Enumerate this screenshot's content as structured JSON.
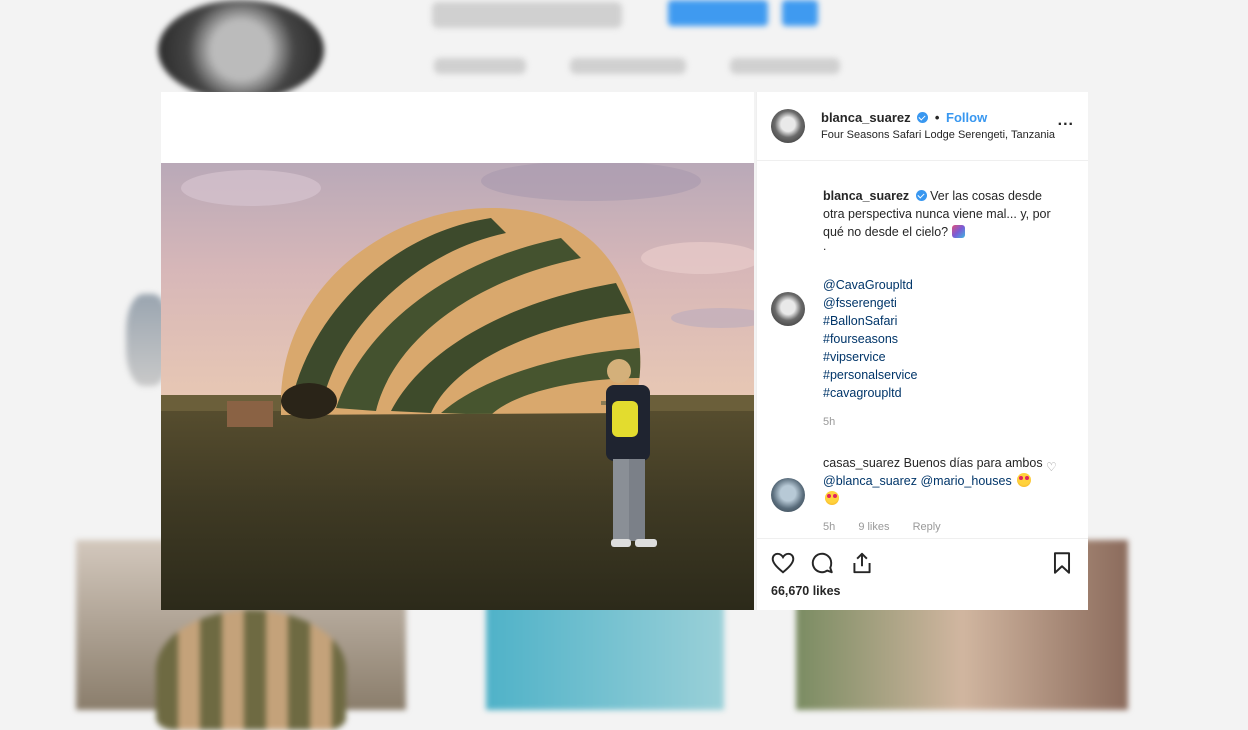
{
  "post": {
    "username": "blanca_suarez",
    "follow_label": "Follow",
    "separator": "•",
    "location": "Four Seasons Safari Lodge Serengeti, Tanzania",
    "more_label": "...",
    "caption": "Ver las cosas desde otra perspectiva nunca viene mal... y, por qué no desde el cielo?",
    "caption_dot": ".",
    "tags": [
      "@CavaGroupltd",
      "@fsserengeti",
      "#BallonSafari",
      "#fourseasons",
      "#vipservice",
      "#personalservice",
      "#cavagroupltd"
    ],
    "time": "5h",
    "likes": "66,670 likes",
    "icons": [
      "heart-icon",
      "comment-icon",
      "share-icon",
      "bookmark-icon",
      "verified-badge-icon",
      "more-options-icon"
    ]
  },
  "comment": {
    "username": "casas_suarez",
    "text_start": "Buenos días para ambos",
    "mention1": "@blanca_suarez",
    "mention2": "@mario_houses",
    "time": "5h",
    "likes": "9 likes",
    "reply": "Reply"
  },
  "colors": {
    "accent": "#3897f0",
    "link": "#003569",
    "text": "#262626",
    "muted": "#999999"
  }
}
